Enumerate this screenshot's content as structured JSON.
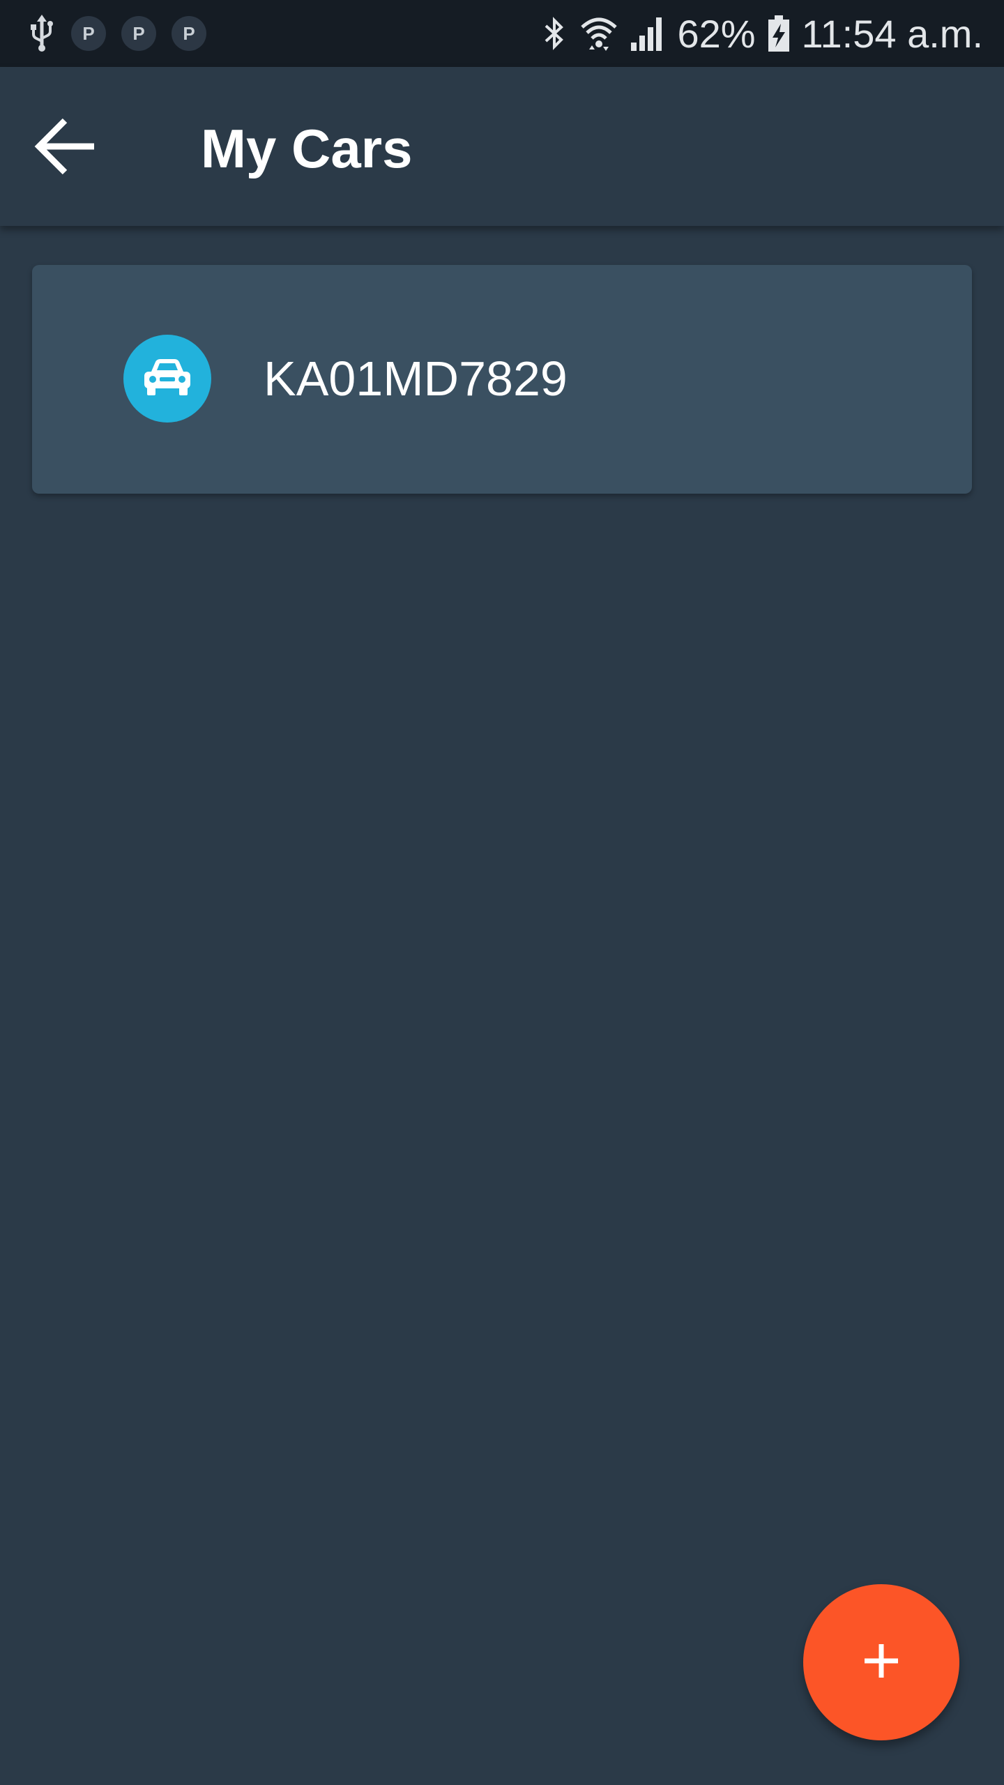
{
  "status_bar": {
    "notification_icons": [
      "usb-icon",
      "parking-icon",
      "parking-icon",
      "parking-icon"
    ],
    "parking_badges": [
      "P",
      "P",
      "P"
    ],
    "system_icons": [
      "bluetooth-icon",
      "wifi-icon",
      "cell-signal-icon",
      "battery-charging-icon"
    ],
    "battery": "62%",
    "time": "11:54 a.m."
  },
  "app_bar": {
    "back_icon": "arrow-back-icon",
    "title": "My Cars"
  },
  "cars": [
    {
      "icon": "car-icon",
      "plate": "KA01MD7829"
    }
  ],
  "fab": {
    "icon": "plus-icon"
  },
  "colors": {
    "background": "#2b3a48",
    "status_bar": "#151c24",
    "card": "#3a5061",
    "car_avatar": "#22b2dc",
    "fab": "#fc5527"
  }
}
